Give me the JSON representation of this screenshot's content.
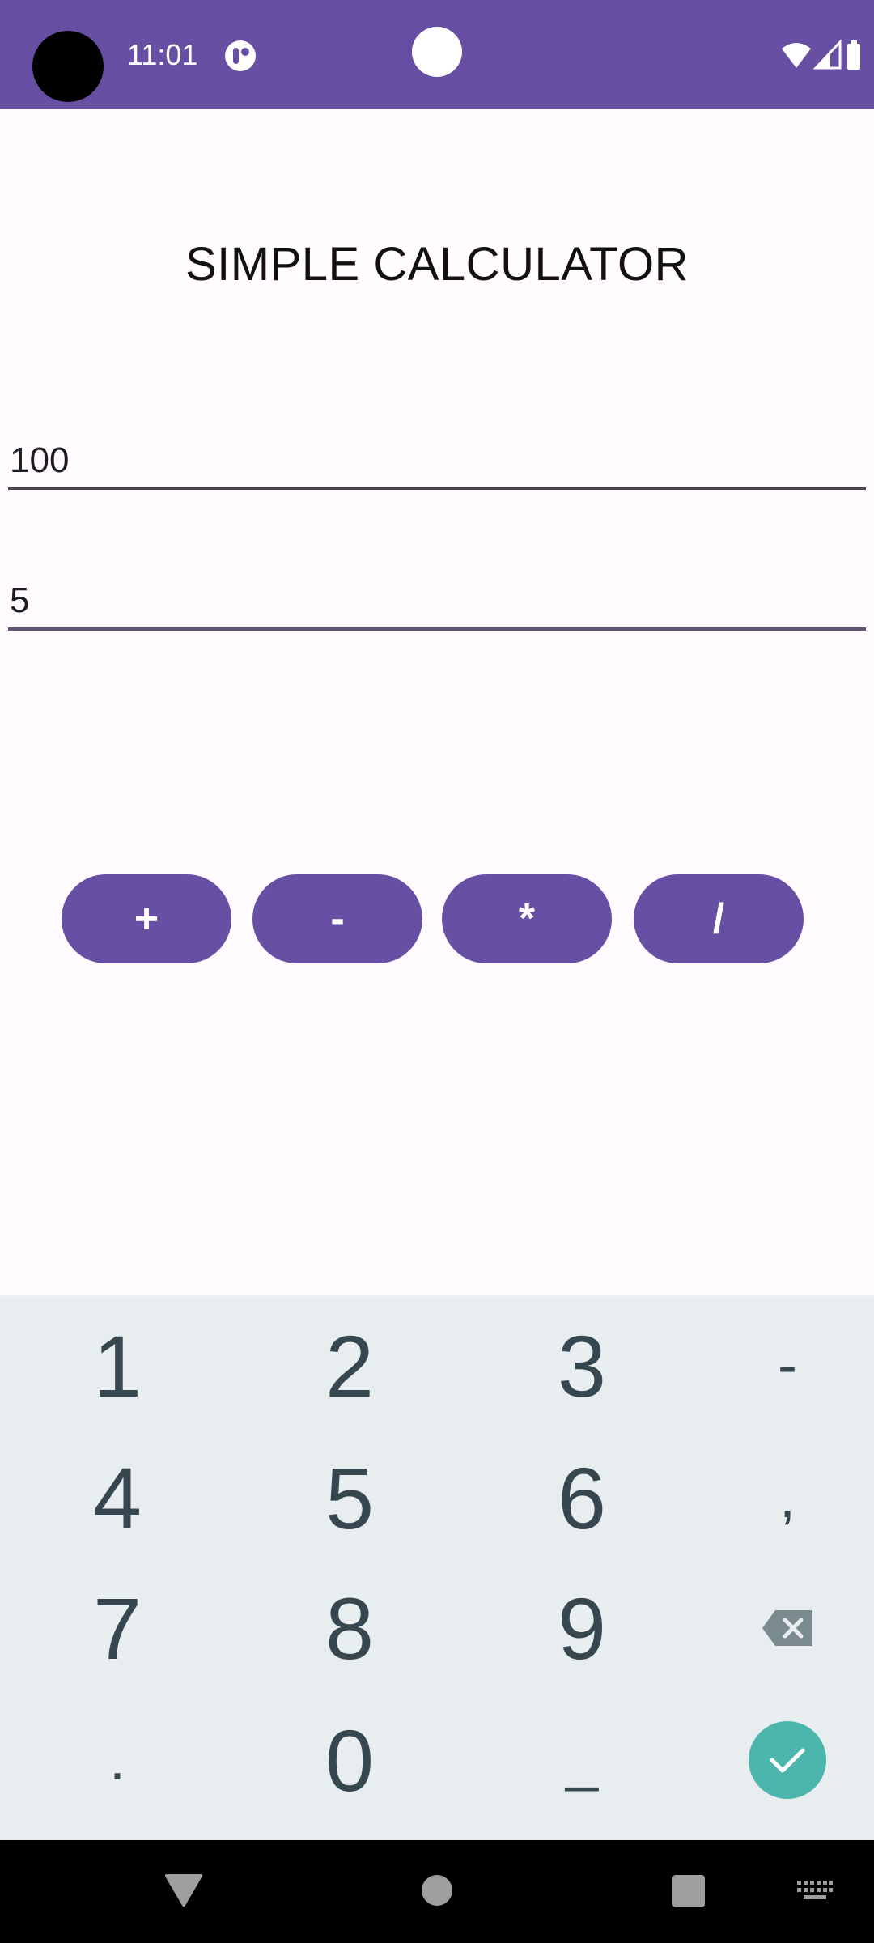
{
  "status_bar": {
    "time": "11:01",
    "icons": [
      "wifi-icon",
      "cellular-signal-icon",
      "battery-icon"
    ]
  },
  "app": {
    "title": "SIMPLE CALCULATOR"
  },
  "inputs": {
    "first_number": "100",
    "second_number": "5"
  },
  "operators": {
    "add": "+",
    "subtract": "-",
    "multiply": "*",
    "divide": "/"
  },
  "keyboard": {
    "row1": [
      "1",
      "2",
      "3",
      "-"
    ],
    "row2": [
      "4",
      "5",
      "6",
      ","
    ],
    "row3": [
      "7",
      "8",
      "9"
    ],
    "row4": [
      ".",
      "0",
      "_"
    ]
  },
  "colors": {
    "primary": "#6750a4",
    "background": "#fffbfe",
    "keyboard_bg": "#e8edef",
    "key_text": "#37474f",
    "done_key": "#4db6ac"
  }
}
